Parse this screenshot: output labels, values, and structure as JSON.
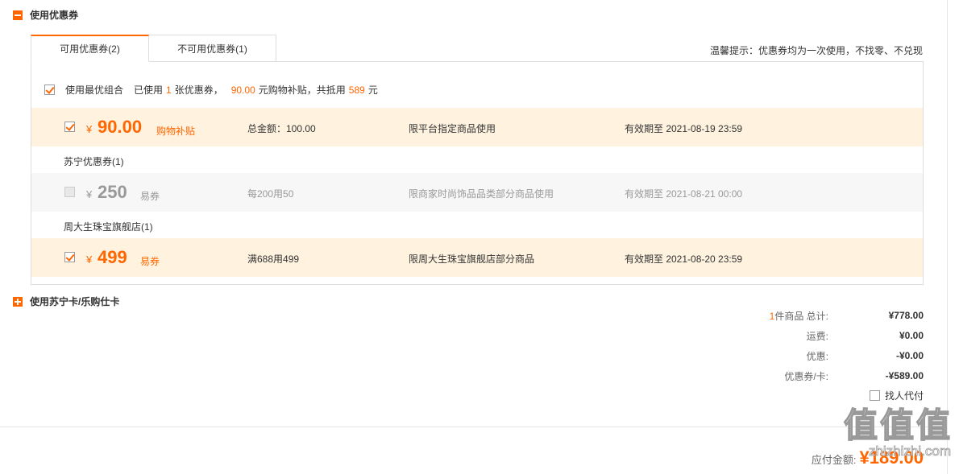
{
  "sections": {
    "coupon_title": "使用优惠券",
    "card_title": "使用苏宁卡/乐购仕卡"
  },
  "tabs": [
    {
      "label": "可用优惠券(2)",
      "active": true
    },
    {
      "label": "不可用优惠券(1)",
      "active": false
    }
  ],
  "tip": "温馨提示：优惠券均为一次使用，不找零、不兑现",
  "best_combo": {
    "checked": true,
    "label": "使用最优组合",
    "used_prefix": "已使用",
    "used_count": "1",
    "used_suffix": "张优惠券，",
    "subsidy_amount": "90.00",
    "subsidy_suffix": "元购物补贴，共抵用",
    "total_offset": "589",
    "total_unit": "元"
  },
  "coupons": [
    {
      "checked": true,
      "yen": "¥",
      "amount": "90.00",
      "kind": "购物补贴",
      "total": "总金额：100.00",
      "limit": "限平台指定商品使用",
      "valid": "有效期至 2021-08-19 23:59"
    },
    {
      "group": "苏宁优惠券(1)",
      "checked": false,
      "yen": "¥",
      "amount": "250",
      "kind": "易券",
      "total": "每200用50",
      "limit": "限商家时尚饰品品类部分商品使用",
      "valid": "有效期至 2021-08-21 00:00"
    },
    {
      "group": "周大生珠宝旗舰店(1)",
      "checked": true,
      "yen": "¥",
      "amount": "499",
      "kind": "易券",
      "total": "满688用499",
      "limit": "限周大生珠宝旗舰店部分商品",
      "valid": "有效期至 2021-08-20 23:59"
    }
  ],
  "summary": {
    "items_count": "1",
    "items_label": "件商品 总计:",
    "items_total": "¥778.00",
    "shipping_label": "运费:",
    "shipping": "¥0.00",
    "discount_label": "优惠:",
    "discount": "-¥0.00",
    "coupon_label": "优惠券/卡:",
    "coupon": "-¥589.00",
    "proxy_label": "找人代付",
    "pay_label": "应付金额:",
    "pay_amount": "¥189.00"
  },
  "watermark": {
    "logo_chars": [
      "值",
      "值",
      "值"
    ],
    "url": "zhizhizhi.com"
  },
  "colors": {
    "accent": "#ff6600",
    "selected_row": "#fff3e0",
    "disabled_row": "#f7f7f7"
  }
}
